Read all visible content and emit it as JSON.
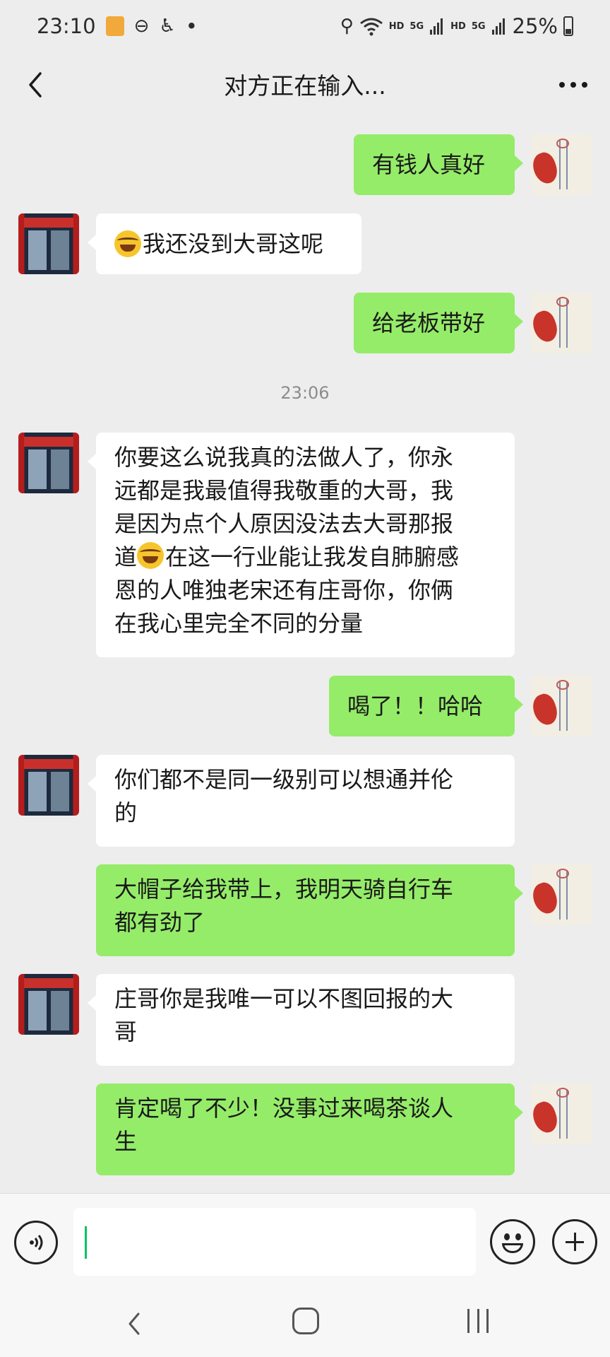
{
  "status_bar": {
    "time": "23:10",
    "dot": "•",
    "hd1": "HD",
    "net1": "5G",
    "hd2": "HD",
    "net2": "5G",
    "battery": "25%",
    "icons": [
      "notification-icon",
      "dnd-icon",
      "accessibility-icon",
      "location-icon",
      "wifi-icon",
      "signal-icon",
      "battery-icon"
    ]
  },
  "header": {
    "title": "对方正在输入...",
    "back_icon": "chevron-left-icon",
    "more_icon": "more-icon"
  },
  "messages": [
    {
      "side": "me",
      "text": "有钱人真好"
    },
    {
      "side": "them",
      "emoji": "laugh-cry-emoji",
      "text": "我还没到大哥这呢"
    },
    {
      "side": "me",
      "text": "给老板带好"
    },
    {
      "side": "them",
      "lines": [
        "你要这么说我真的法做人了，你永",
        "远都是我最值得我敬重的大哥，我",
        "是因为点个人原因没法去大哥那报"
      ],
      "line4_pre": "道",
      "line4_emoji": "laugh-cry-emoji",
      "line4_post": "在这一行业能让我发自肺腑感",
      "lines_tail": [
        "恩的人唯独老宋还有庄哥你，你俩",
        "在我心里完全不同的分量"
      ]
    },
    {
      "side": "me",
      "text": "喝了！！哈哈"
    },
    {
      "side": "them",
      "lines": [
        "你们都不是同一级别可以想通并伦",
        "的"
      ]
    },
    {
      "side": "me",
      "lines": [
        "大帽子给我带上，我明天骑自行车",
        "都有劲了"
      ]
    },
    {
      "side": "them",
      "lines": [
        "庄哥你是我唯一可以不图回报的大",
        "哥"
      ]
    },
    {
      "side": "me",
      "lines": [
        "肯定喝了不少！没事过来喝茶谈人",
        "生"
      ]
    }
  ],
  "timestamp": "23:06",
  "input_bar": {
    "voice_icon": "voice-icon",
    "emoji_icon": "emoji-icon",
    "plus_icon": "plus-icon",
    "text": ""
  },
  "nav_bar": {
    "back_icon": "nav-back-icon",
    "home_icon": "nav-home-icon",
    "recents_icon": "nav-recents-icon"
  },
  "colors": {
    "background": "#ededed",
    "my_bubble": "#95ec69",
    "their_bubble": "#ffffff",
    "accent": "#07c160"
  }
}
